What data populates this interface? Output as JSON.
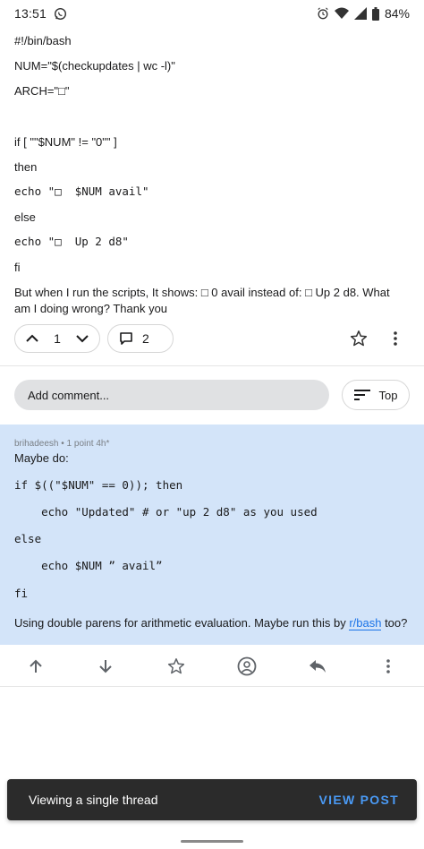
{
  "status_bar": {
    "time": "13:51",
    "battery": "84%",
    "icons": [
      "whatsapp-icon",
      "alarm-icon",
      "wifi-icon",
      "signal-icon",
      "battery-icon"
    ]
  },
  "post": {
    "lines": {
      "shebang": "#!/bin/bash",
      "num": "NUM=\"$(checkupdates | wc -l)\"",
      "arch": "ARCH=\"□\"",
      "if": "if [ \"\"$NUM\" != \"0\"\" ]",
      "then": "then",
      "echo1": "echo \"□  $NUM avail\"",
      "else": "else",
      "echo2": "echo \"□  Up 2 d8\"",
      "fi": "fi"
    },
    "question": "But when I run the scripts, It shows: □ 0 avail instead of: □ Up 2 d8. What am I doing wrong? Thank you",
    "vote_count": "1",
    "comment_count": "2"
  },
  "comment_bar": {
    "placeholder": "Add comment...",
    "sort_label": "Top"
  },
  "reply": {
    "author": "brihadeesh",
    "meta": "• 1 point 4h*",
    "intro": "Maybe do:",
    "code": {
      "if": "if $((\"$NUM\" == 0)); then",
      "echo1": "    echo \"Updated\" # or \"up 2 d8\" as you used",
      "else": "else",
      "echo2": "    echo $NUM ” avail”",
      "fi": "fi"
    },
    "outro_before": "Using double parens for arithmetic evaluation. Maybe run this by ",
    "outro_link": "r/bash",
    "outro_after": " too?"
  },
  "snackbar": {
    "text": "Viewing a single thread",
    "action": "VIEW POST"
  },
  "colors": {
    "reply_bg": "#d3e4f9",
    "link": "#1a73e8",
    "snackbar_bg": "#2b2b2b",
    "snackbar_action": "#4a9af5"
  }
}
